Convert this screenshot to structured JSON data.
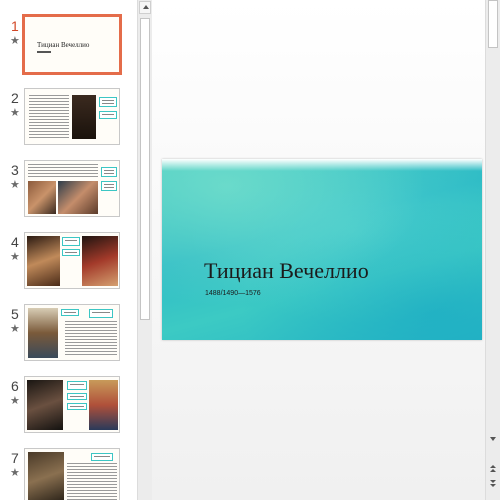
{
  "thumbnails": [
    {
      "number": "1",
      "title": "Тициан Вечеллио"
    },
    {
      "number": "2"
    },
    {
      "number": "3"
    },
    {
      "number": "4"
    },
    {
      "number": "5"
    },
    {
      "number": "6"
    },
    {
      "number": "7"
    }
  ],
  "slide": {
    "title": "Тициан Вечеллио",
    "subtitle": "1488/1490—1576"
  },
  "icons": {
    "star": "animation-star-icon",
    "scroll_up": "scroll-up-arrow-icon",
    "scroll_down": "scroll-down-arrow-icon",
    "prev_slide": "previous-slide-icon",
    "next_slide": "next-slide-icon"
  },
  "colors": {
    "active_highlight": "#e46c4a",
    "slide_aqua": "#34c2c8",
    "slide_title": "#1b1b1b"
  }
}
